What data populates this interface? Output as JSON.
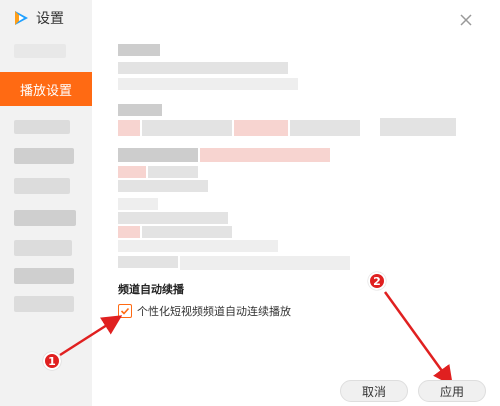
{
  "window": {
    "title": "设置"
  },
  "sidebar": {
    "active_item": "播放设置"
  },
  "main": {
    "section_title": "频道自动续播",
    "checkbox": {
      "label": "个性化短视频频道自动连续播放",
      "checked": true
    }
  },
  "footer": {
    "cancel_label": "取消",
    "apply_label": "应用"
  },
  "annotations": {
    "callout_1": "1",
    "callout_2": "2"
  },
  "colors": {
    "accent": "#ff6a13",
    "callout": "#e02020"
  }
}
